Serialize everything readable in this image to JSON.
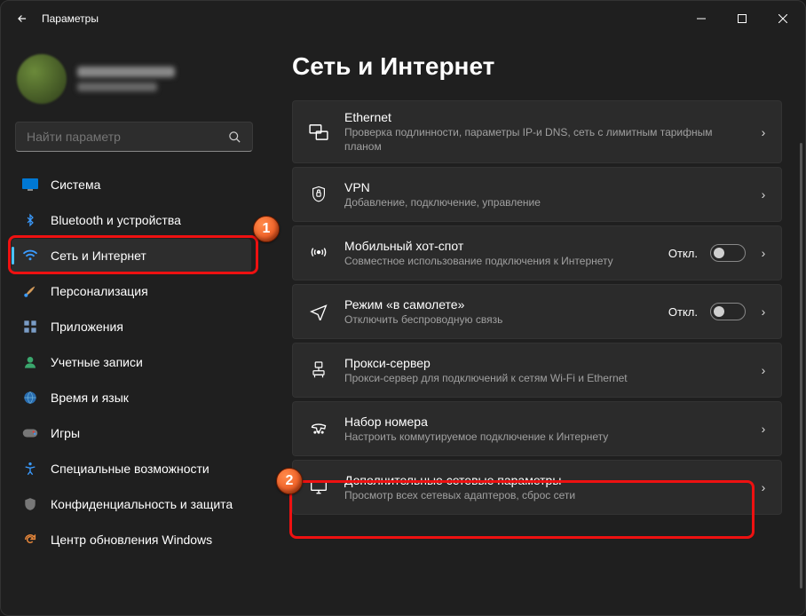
{
  "titlebar": {
    "title": "Параметры"
  },
  "search": {
    "placeholder": "Найти параметр"
  },
  "sidebar": {
    "items": [
      {
        "label": "Система"
      },
      {
        "label": "Bluetooth и устройства"
      },
      {
        "label": "Сеть и Интернет"
      },
      {
        "label": "Персонализация"
      },
      {
        "label": "Приложения"
      },
      {
        "label": "Учетные записи"
      },
      {
        "label": "Время и язык"
      },
      {
        "label": "Игры"
      },
      {
        "label": "Специальные возможности"
      },
      {
        "label": "Конфиденциальность и защита"
      },
      {
        "label": "Центр обновления Windows"
      }
    ]
  },
  "main": {
    "title": "Сеть и Интернет",
    "cards": [
      {
        "title": "Ethernet",
        "desc": "Проверка подлинности, параметры IP-и DNS, сеть с лимитным тарифным планом"
      },
      {
        "title": "VPN",
        "desc": "Добавление, подключение, управление"
      },
      {
        "title": "Мобильный хот-спот",
        "desc": "Совместное использование подключения к Интернету",
        "toggle": "Откл."
      },
      {
        "title": "Режим «в самолете»",
        "desc": "Отключить беспроводную связь",
        "toggle": "Откл."
      },
      {
        "title": "Прокси-сервер",
        "desc": "Прокси-сервер для подключений к сетям Wi-Fi и Ethernet"
      },
      {
        "title": "Набор номера",
        "desc": "Настроить коммутируемое подключение к Интернету"
      },
      {
        "title": "Дополнительные сетевые параметры",
        "desc": "Просмотр всех сетевых адаптеров, сброс сети"
      }
    ]
  },
  "annotations": {
    "b1": "1",
    "b2": "2"
  }
}
